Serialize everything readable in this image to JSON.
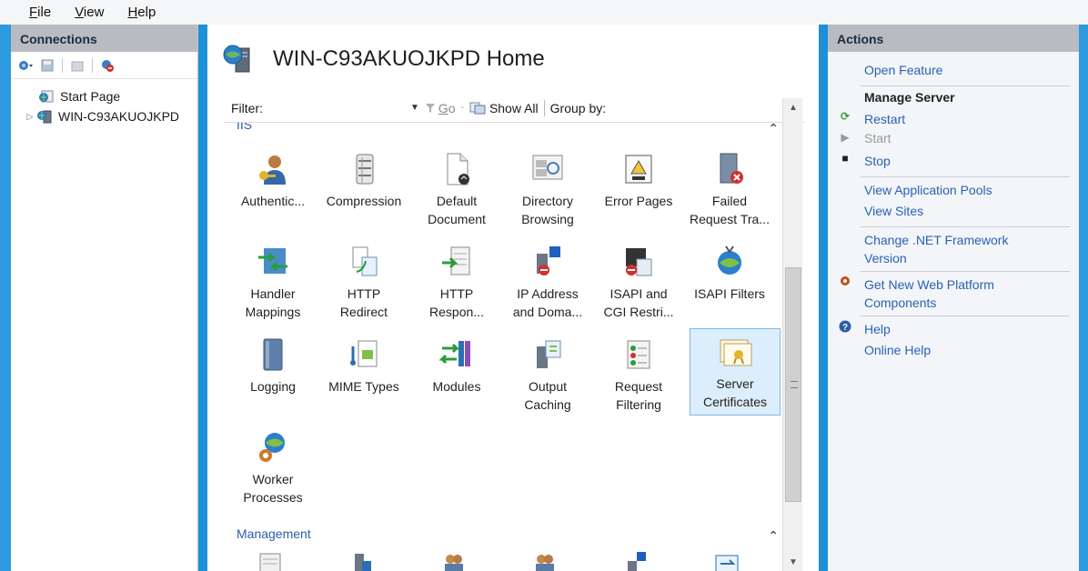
{
  "menu": {
    "file": "File",
    "view": "View",
    "help": "Help"
  },
  "connections": {
    "header": "Connections",
    "tree": [
      {
        "label": "Start Page"
      },
      {
        "label": "WIN-C93AKUOJKPD",
        "expander": "▷"
      }
    ]
  },
  "main": {
    "title": "WIN-C93AKUOJKPD Home",
    "filter_label": "Filter:",
    "go_label": "Go",
    "show_all_label": "Show All",
    "group_by_label": "Group by:",
    "section_iis": "IIS",
    "section_management": "Management",
    "features": [
      {
        "line1": "Authentic...",
        "line2": "",
        "icon": "user-key-icon"
      },
      {
        "line1": "Compression",
        "line2": "",
        "icon": "compression-icon"
      },
      {
        "line1": "Default",
        "line2": "Document",
        "icon": "document-icon"
      },
      {
        "line1": "Directory",
        "line2": "Browsing",
        "icon": "directory-browsing-icon"
      },
      {
        "line1": "Error Pages",
        "line2": "",
        "icon": "error-pages-icon"
      },
      {
        "line1": "Failed",
        "line2": "Request Tra...",
        "icon": "failed-request-icon"
      },
      {
        "line1": "Handler",
        "line2": "Mappings",
        "icon": "handler-icon"
      },
      {
        "line1": "HTTP",
        "line2": "Redirect",
        "icon": "redirect-icon"
      },
      {
        "line1": "HTTP",
        "line2": "Respon...",
        "icon": "response-headers-icon"
      },
      {
        "line1": "IP Address",
        "line2": "and Doma...",
        "icon": "ip-restrictions-icon"
      },
      {
        "line1": "ISAPI and",
        "line2": "CGI Restri...",
        "icon": "isapi-cgi-icon"
      },
      {
        "line1": "ISAPI Filters",
        "line2": "",
        "icon": "isapi-filters-icon"
      },
      {
        "line1": "Logging",
        "line2": "",
        "icon": "logging-icon"
      },
      {
        "line1": "MIME Types",
        "line2": "",
        "icon": "mime-icon"
      },
      {
        "line1": "Modules",
        "line2": "",
        "icon": "modules-icon"
      },
      {
        "line1": "Output",
        "line2": "Caching",
        "icon": "output-caching-icon"
      },
      {
        "line1": "Request",
        "line2": "Filtering",
        "icon": "request-filtering-icon"
      },
      {
        "line1": "Server",
        "line2": "Certificates",
        "icon": "certificate-icon"
      },
      {
        "line1": "Worker",
        "line2": "Processes",
        "icon": "worker-processes-icon"
      }
    ]
  },
  "actions": {
    "header": "Actions",
    "open_feature": "Open Feature",
    "manage_server": "Manage Server",
    "restart": "Restart",
    "start": "Start",
    "stop": "Stop",
    "view_app_pools": "View Application Pools",
    "view_sites": "View Sites",
    "change_net_line1": "Change .NET Framework",
    "change_net_line2": "Version",
    "get_new_line1": "Get New Web Platform",
    "get_new_line2": "Components",
    "help": "Help",
    "online_help": "Online Help"
  },
  "colors": {
    "accent_blue": "#2962b5",
    "frame_blue": "#2d9ae0",
    "header_gray": "#b8bcc2",
    "selected_tile": "#dceefb"
  }
}
